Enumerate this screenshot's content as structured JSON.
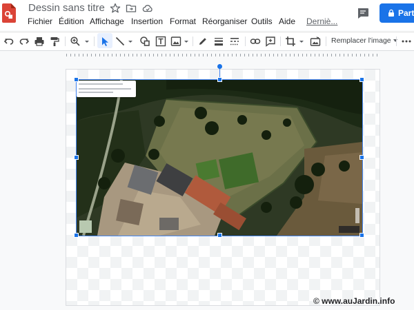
{
  "app": {
    "title": "Dessin sans titre",
    "icon": "google-drawings-logo",
    "brand_color": "#db4437"
  },
  "title_icons": [
    "star-icon",
    "move-to-folder-icon",
    "cloud-status-icon"
  ],
  "menu": {
    "items": [
      "Fichier",
      "Édition",
      "Affichage",
      "Insertion",
      "Format",
      "Réorganiser",
      "Outils",
      "Aide"
    ],
    "last_edit": "Derniè..."
  },
  "share": {
    "label": "Parta",
    "icon": "lock-icon",
    "color": "#1a73e8"
  },
  "toolbar": {
    "tools": [
      "undo-icon",
      "redo-icon",
      "print-icon",
      "paint-format-icon",
      "zoom-icon",
      "select-icon",
      "line-icon",
      "shape-icon",
      "text-box-icon",
      "image-icon",
      "pen-icon",
      "line-weight-icon",
      "line-dash-icon",
      "link-icon",
      "comment-icon",
      "crop-icon",
      "image-options-icon",
      "more-icon"
    ],
    "replace_image": "Remplacer l'image"
  },
  "canvas": {
    "selected_object": "aerial-photo",
    "accent": "#4285f4"
  },
  "watermark": {
    "text": "© www.auJardin.info"
  }
}
